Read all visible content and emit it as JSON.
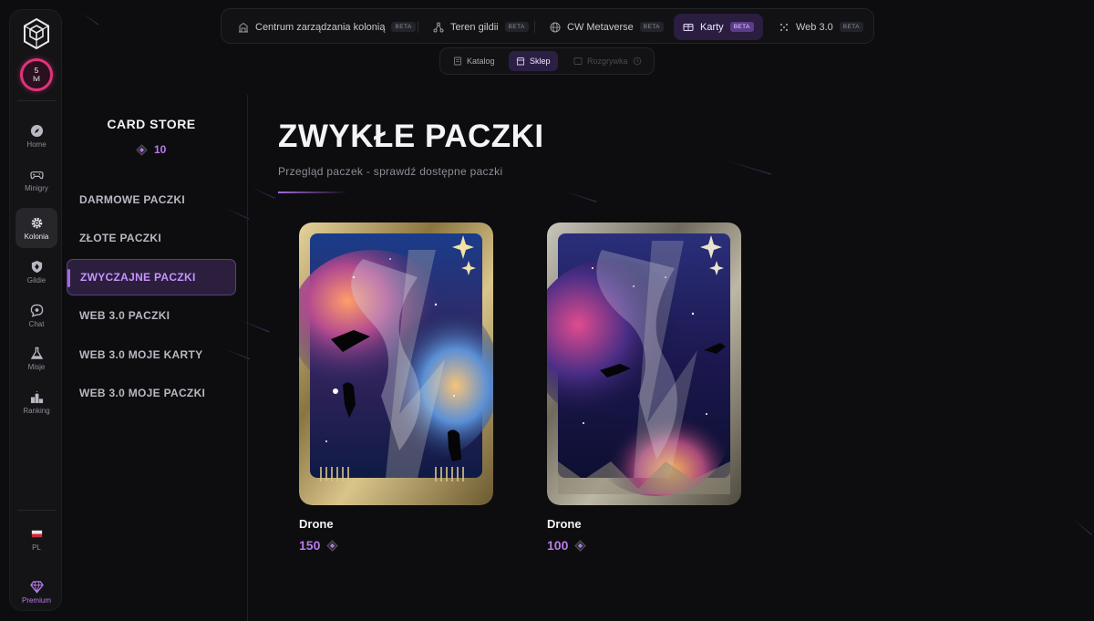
{
  "rail": {
    "avatar": {
      "level": "5",
      "level_unit": "lvl"
    },
    "items": [
      {
        "label": "Home",
        "icon": "compass-icon"
      },
      {
        "label": "Minigry",
        "icon": "gamepad-icon"
      },
      {
        "label": "Kolonia",
        "icon": "gear-icon",
        "active": true
      },
      {
        "label": "Gildie",
        "icon": "shield-icon"
      },
      {
        "label": "Chat",
        "icon": "chat-icon"
      },
      {
        "label": "Misje",
        "icon": "flask-icon"
      },
      {
        "label": "Ranking",
        "icon": "podium-icon"
      }
    ],
    "language": "PL",
    "premium": "Premium"
  },
  "topnav": {
    "items": [
      {
        "label": "Centrum zarządzania kolonią",
        "badge": "BETA",
        "icon": "building-icon"
      },
      {
        "label": "Teren gildii",
        "badge": "BETA",
        "icon": "network-icon"
      },
      {
        "label": "CW Metaverse",
        "badge": "BETA",
        "icon": "globe-icon"
      },
      {
        "label": "Karty",
        "badge": "BETA",
        "icon": "cards-icon",
        "active": true
      },
      {
        "label": "Web 3.0",
        "badge": "BETA",
        "icon": "nodes-icon"
      }
    ]
  },
  "subnav": {
    "items": [
      {
        "label": "Katalog",
        "icon": "catalog-icon"
      },
      {
        "label": "Sklep",
        "icon": "shop-icon",
        "active": true
      },
      {
        "label": "Rozgrywka",
        "icon": "play-icon",
        "disabled": true
      }
    ]
  },
  "store": {
    "title": "CARD STORE",
    "balance": "10",
    "menu": [
      {
        "label": "DARMOWE PACZKI"
      },
      {
        "label": "ZŁOTE PACZKI"
      },
      {
        "label": "ZWYCZAJNE PACZKI",
        "active": true
      },
      {
        "label": "WEB 3.0 PACZKI"
      },
      {
        "label": "WEB 3.0 MOJE KARTY"
      },
      {
        "label": "WEB 3.0 MOJE PACZKI"
      }
    ]
  },
  "main": {
    "title": "ZWYKŁE PACZKI",
    "subtitle": "Przegląd paczek - sprawdź dostępne paczki",
    "packs": [
      {
        "name": "Drone",
        "price": "150"
      },
      {
        "name": "Drone",
        "price": "100"
      }
    ]
  },
  "colors": {
    "accent": "#b77be8",
    "background": "#0d0d0f",
    "avatar_ring": "#e0337b",
    "card_frame": "#c9b27a"
  }
}
